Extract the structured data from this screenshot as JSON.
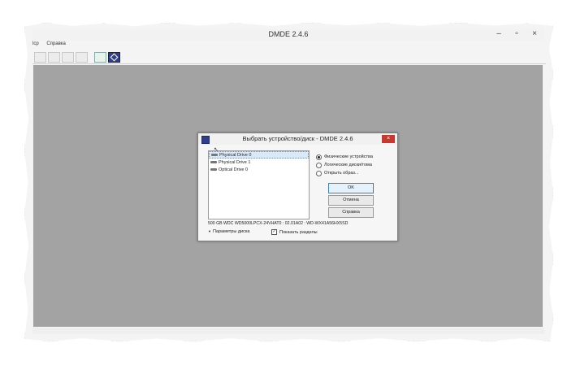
{
  "window": {
    "title": "DMDE 2.4.6",
    "controls": {
      "minimize": "–",
      "maximize": "▫",
      "close": "×"
    }
  },
  "menu": {
    "items": [
      "lcp",
      "Справка"
    ]
  },
  "toolbar": {
    "buttons": [
      {
        "icon": "open-drive-icon"
      },
      {
        "icon": "open-volume-icon"
      },
      {
        "icon": "disk-editor-icon"
      },
      {
        "icon": "partitions-icon"
      },
      {
        "icon": "recovery-icon"
      },
      {
        "icon": "dmde-logo-icon"
      }
    ]
  },
  "dialog": {
    "title": "Выбрать устройство/диск - DMDE 2.4.6",
    "close": "×",
    "drives": [
      {
        "label": "Physical Drive 0",
        "selected": true
      },
      {
        "label": "Physical Drive 1",
        "selected": false
      },
      {
        "label": "Optical Drive 0",
        "selected": false
      }
    ],
    "modes": [
      {
        "label": "Физические устройства",
        "checked": true
      },
      {
        "label": "Логические диски/тома",
        "checked": false
      },
      {
        "label": "Открыть образ...",
        "checked": false
      }
    ],
    "buttons": {
      "ok": "OK",
      "cancel": "Отмена",
      "help": "Справка"
    },
    "drive_info": "500 GB WDC WD5000LPCX-24VHAT0 : 02.01A02 : WD-WX41A56HX5SD",
    "disk_params": "Параметры диска",
    "show_partitions": {
      "label": "Показать разделы",
      "checked": true
    }
  },
  "colors": {
    "workspace": "#a3a3a3",
    "close_button": "#c8382e",
    "selection": "#d9e9f8",
    "logo_blue": "#2f3f8f"
  }
}
